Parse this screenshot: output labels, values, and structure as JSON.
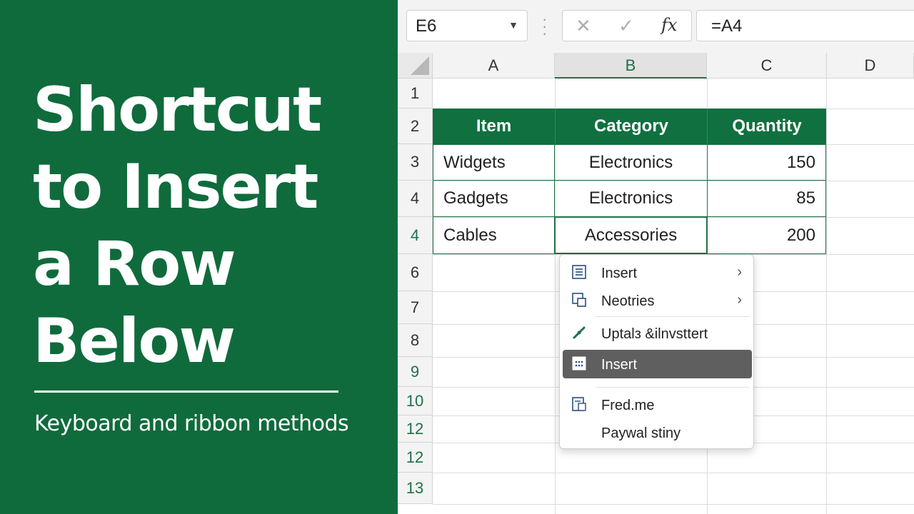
{
  "promo": {
    "title_lines": [
      "Shortcut",
      "to Insert",
      "a Row",
      "Below"
    ],
    "subtitle": "Keyboard and ribbon methods",
    "background_color": "#0f6b3c"
  },
  "formula_bar": {
    "name_box": "E6",
    "cancel_icon": "✕",
    "enter_icon": "✓",
    "fx_label": "fx",
    "formula": "=A4"
  },
  "grid": {
    "columns": [
      "A",
      "B",
      "C",
      "D"
    ],
    "selected_column": "B",
    "row_headers": [
      "1",
      "2",
      "3",
      "4",
      "4",
      "6",
      "7",
      "8",
      "9",
      "10",
      "12",
      "12",
      "13"
    ],
    "table": {
      "headers": [
        "Item",
        "Category",
        "Quantity"
      ],
      "rows": [
        [
          "Widgets",
          "Electronics",
          "150"
        ],
        [
          "Gadgets",
          "Electronics",
          "85"
        ],
        [
          "Cables",
          "Accessories",
          "200"
        ]
      ]
    }
  },
  "context_menu": {
    "items": [
      {
        "label": "Insert",
        "icon": "list-icon",
        "submenu": true
      },
      {
        "label": "Neotries",
        "icon": "table-icon",
        "submenu": true
      },
      {
        "label": "Uptalз &ilnvsttert",
        "icon": "link-icon",
        "submenu": false
      },
      {
        "label": "Insert",
        "icon": "grid-icon",
        "submenu": false,
        "highlighted": true
      },
      {
        "label": "Fred.me",
        "icon": "sheet-icon",
        "submenu": false
      },
      {
        "label": "Paywal stiny",
        "icon": "",
        "submenu": false
      }
    ]
  },
  "colors": {
    "excel_green": "#1e7145",
    "header_fill": "#10703f",
    "menu_highlight": "#5f5f5f"
  }
}
